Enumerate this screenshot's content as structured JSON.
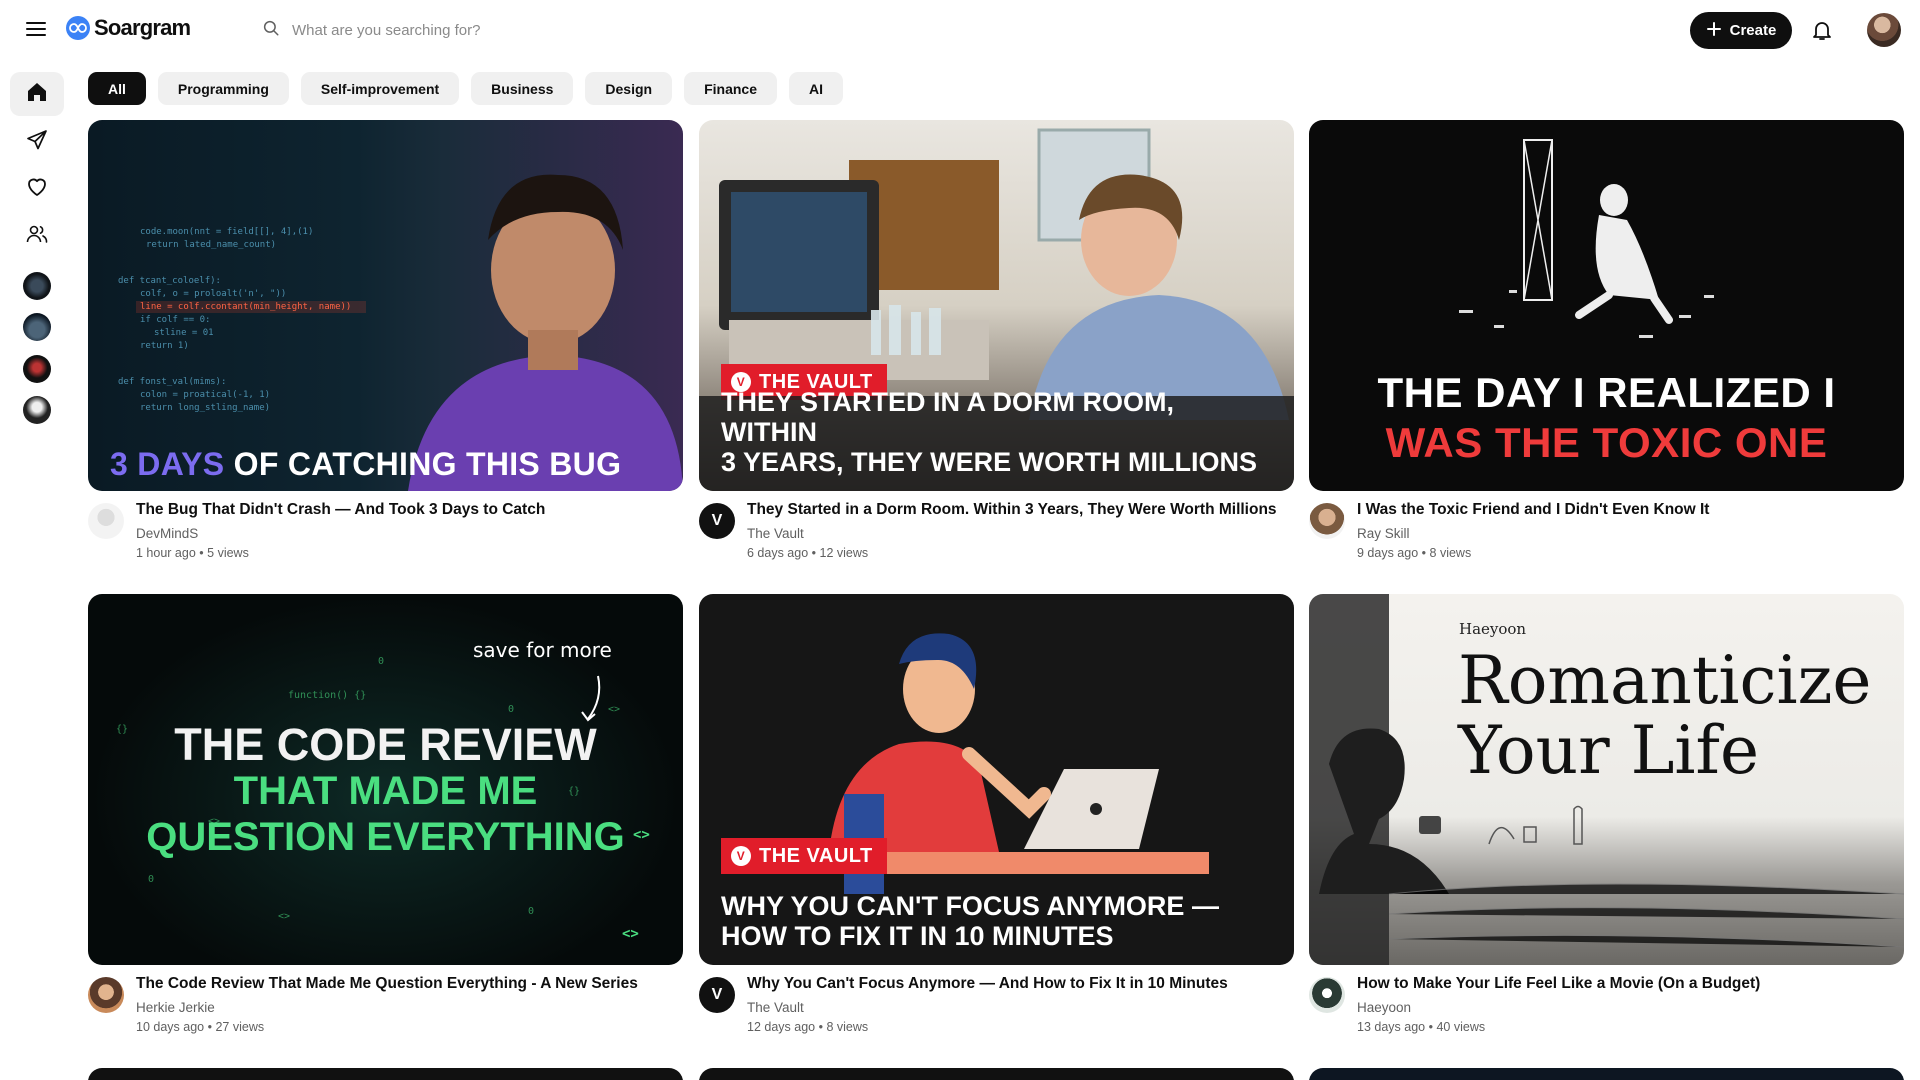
{
  "app": {
    "name": "Soargram",
    "brand_color": "#3b82f6"
  },
  "header": {
    "search_placeholder": "What are you searching for?",
    "create_label": "Create"
  },
  "sidebar": {
    "icons": [
      "home-icon",
      "send-icon",
      "heart-icon",
      "users-icon"
    ]
  },
  "chips": [
    {
      "label": "All",
      "active": true
    },
    {
      "label": "Programming",
      "active": false
    },
    {
      "label": "Self-improvement",
      "active": false
    },
    {
      "label": "Business",
      "active": false
    },
    {
      "label": "Design",
      "active": false
    },
    {
      "label": "Finance",
      "active": false
    },
    {
      "label": "AI",
      "active": false
    }
  ],
  "videos": [
    {
      "title": "The Bug That Didn't Crash — And Took 3 Days to Catch",
      "channel": "DevMindS",
      "age": "1 hour ago",
      "views": "5 views",
      "thumb_text_highlight": "3 DAYS",
      "thumb_text_rest": "OF CATCHING THIS BUG"
    },
    {
      "title": "They Started in a Dorm Room. Within 3 Years, They Were Worth Millions",
      "channel": "The Vault",
      "age": "6 days ago",
      "views": "12 views",
      "thumb_badge": "THE VAULT",
      "thumb_text_line1": "THEY STARTED IN A DORM ROOM, WITHIN",
      "thumb_text_line2": "3 YEARS, THEY WERE WORTH MILLIONS"
    },
    {
      "title": "I Was the Toxic Friend and I Didn't Even Know It",
      "channel": "Ray Skill",
      "age": "9 days ago",
      "views": "8 views",
      "thumb_text_line1": "THE DAY I REALIZED I",
      "thumb_text_line2": "WAS THE TOXIC ONE"
    },
    {
      "title": "The Code Review That Made Me Question Everything - A New Series",
      "channel": "Herkie Jerkie",
      "age": "10 days ago",
      "views": "27 views",
      "thumb_note": "save for more",
      "thumb_text_line1": "THE CODE REVIEW",
      "thumb_text_line2": "THAT MADE ME",
      "thumb_text_line3": "QUESTION EVERYTHING"
    },
    {
      "title": "Why You Can't Focus Anymore — And How to Fix It in 10 Minutes",
      "channel": "The Vault",
      "age": "12 days ago",
      "views": "8 views",
      "thumb_badge": "THE VAULT",
      "thumb_text_line1": "WHY YOU CAN'T FOCUS ANYMORE —",
      "thumb_text_line2": "HOW TO FIX IT IN 10 MINUTES"
    },
    {
      "title": "How to Make Your Life Feel Like a Movie (On a Budget)",
      "channel": "Haeyoon",
      "age": "13 days ago",
      "views": "40 views",
      "thumb_brand": "Haeyoon",
      "thumb_text_line1": "Romanticize",
      "thumb_text_line2": "Your Life"
    }
  ],
  "stats_separator": "•",
  "colors": {
    "chip_bg": "#f0f0f0",
    "accent_dark": "#0f0f0f",
    "vault_red": "#e11d2a",
    "code_green": "#4ade80",
    "purple": "#7c6cf0",
    "toxic_red": "#ef3b3b"
  }
}
